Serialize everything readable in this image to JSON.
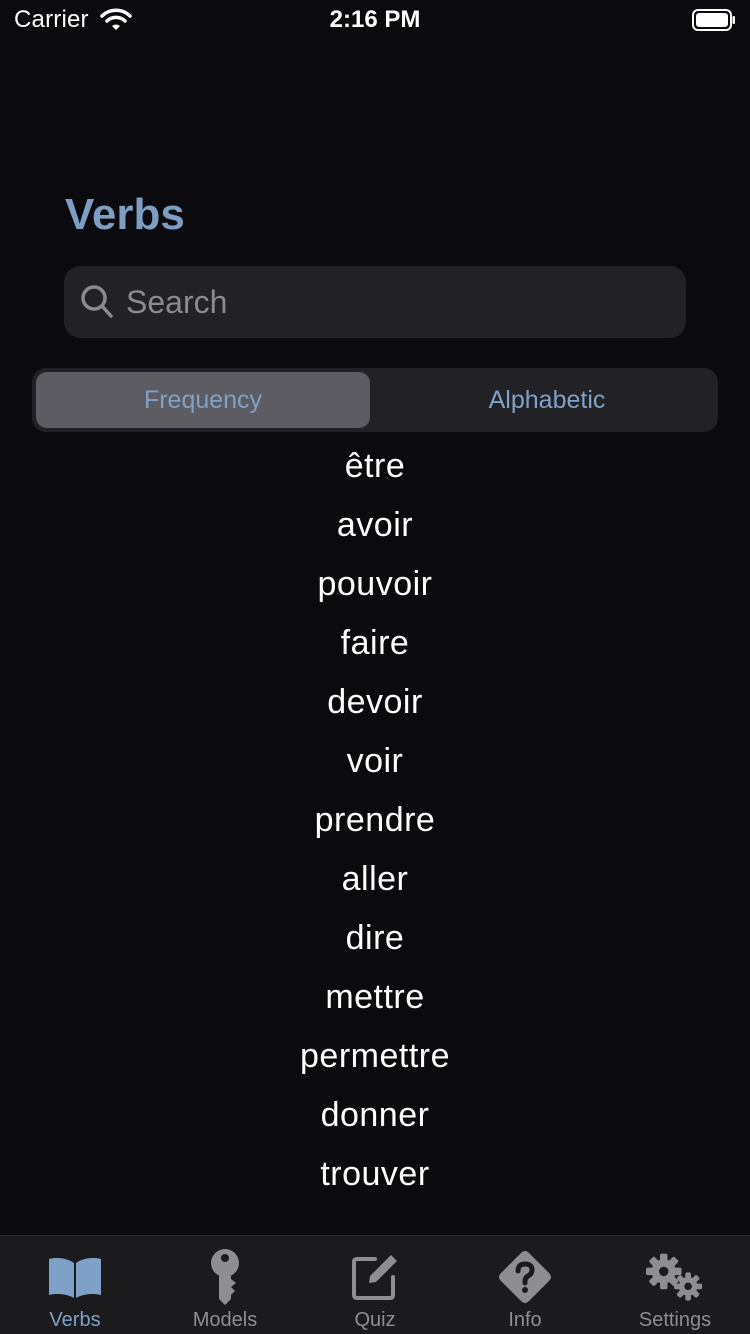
{
  "status_bar": {
    "carrier": "Carrier",
    "time": "2:16 PM"
  },
  "title": "Verbs",
  "search": {
    "placeholder": "Search",
    "value": ""
  },
  "segments": {
    "selected": "Frequency",
    "items": [
      "Frequency",
      "Alphabetic"
    ]
  },
  "verbs": [
    "être",
    "avoir",
    "pouvoir",
    "faire",
    "devoir",
    "voir",
    "prendre",
    "aller",
    "dire",
    "mettre",
    "permettre",
    "donner",
    "trouver"
  ],
  "tab_bar": {
    "active": "Verbs",
    "tabs": [
      {
        "label": "Verbs",
        "icon": "book-icon"
      },
      {
        "label": "Models",
        "icon": "key-icon"
      },
      {
        "label": "Quiz",
        "icon": "edit-icon"
      },
      {
        "label": "Info",
        "icon": "question-diamond-icon"
      },
      {
        "label": "Settings",
        "icon": "gears-icon"
      }
    ]
  },
  "colors": {
    "background": "#0b0a0e",
    "accent": "#7d9dc2",
    "control_bg": "#222126",
    "selected_segment": "#5d5c63",
    "tab_inactive": "#8e8e92"
  }
}
